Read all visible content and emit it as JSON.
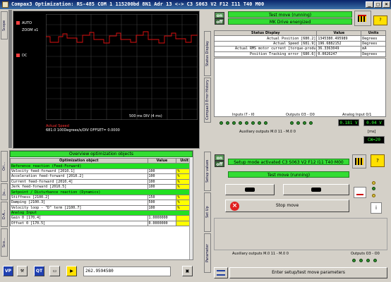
{
  "window": {
    "title": "Compax3 Optimization: RS-485 COM 1  115200bd 8N1 Adr 13 <-> C3 S063 V2 F12 I11 T40 M00"
  },
  "left_tabs": {
    "scope": "Scope",
    "top_tab1": "Ori...",
    "top_tab2": "Ju...",
    "top_tab3": "D-A...",
    "top_tab4": "Sco..."
  },
  "scope": {
    "mode_auto": "AUTO",
    "mode_zoom": "ZOOM x1",
    "dc": "DC",
    "time_label": "500 ms DIV (4 ms)",
    "legend_1": "Actual Speed",
    "legend_2": "681.0 100Degrees/s/DIV    OFFSET= 0.0000"
  },
  "status": {
    "on": "on",
    "off": "off",
    "test_move_banner": "Test move (running)",
    "mk_drive_banner": "MK Drive energized",
    "side_tabs": [
      "Status Display",
      "Compax3 Error History"
    ],
    "table": {
      "headers": [
        "Status Display",
        "Value",
        "Units"
      ],
      "rows": [
        [
          "Actual Position [680.2]",
          "1345380.495989",
          "Degrees"
        ],
        [
          "Actual Speed [681.9]",
          "196.6882152",
          "Degrees"
        ],
        [
          "Actual RMS motor current [torque-produ",
          "36.3363049",
          "mA"
        ],
        [
          "Position Tracking error [680.6]",
          "0.0026247",
          "Degrees"
        ]
      ]
    },
    "inputs_label": "Inputs I7 - I0",
    "outputs_label": "Outputs O3 - O0",
    "analog_label": "Analog Input 0/1",
    "analog_0": "0.181 V",
    "analog_1": "0.04 V",
    "aux_label": "Auxiliary outputs M.0 11 - M.0 0",
    "ms_label": "[ms]",
    "cw_value": "CW=20"
  },
  "optimization": {
    "header": "Overview optimization objects",
    "side_tabs": [
      "Ori...",
      "Ju...",
      "D-A..."
    ],
    "columns": [
      "Optimization object",
      "Value",
      "Unit"
    ],
    "sections": [
      {
        "title": "Reference reaction (Feed-Forward)",
        "rows": [
          [
            "Velocity feed-forward [2010.1]",
            "100",
            "%"
          ],
          [
            "Acceleration feed-forward [2010.2]",
            "100",
            "%"
          ],
          [
            "Current feed-forward [2010.4]",
            "100",
            "%"
          ],
          [
            "Jerk feed-forward [2010.5]",
            "100",
            "%"
          ]
        ]
      },
      {
        "title": "Setpoint / Disturbance reaction (Dynamics)",
        "rows": [
          [
            "Stiffness [2100.2]",
            "150",
            "%"
          ],
          [
            "Damping [2100.3]",
            "500",
            "%"
          ],
          [
            "Velocity loop - \"D\" term [2100.7]",
            "100",
            "%"
          ]
        ]
      },
      {
        "title": "Analog Input",
        "rows": [
          [
            "Gain 0 [170.4]",
            "1.0000000",
            ""
          ],
          [
            "Offset 0 [170.5]",
            "0.0000000",
            ""
          ]
        ]
      }
    ]
  },
  "setup": {
    "on": "on",
    "off": "off",
    "side_tabs": [
      "Setup values",
      "Set Up",
      "Parameter"
    ],
    "mode_banner": "Setup mode activated C3 S063 V2 F12 I11 T40 M00",
    "test_move_banner": "Test move (running)",
    "stop_label": "Stop move",
    "aux_label": "Auxiliary outputs M.0 11 - M.0 0",
    "outputs_label": "Outputs O3 - O0",
    "enter_label": "Enter setup/test move parameters"
  },
  "toolbar": {
    "vp_label": "VP",
    "qt_label": "QT",
    "value_field": "262.9594580"
  }
}
